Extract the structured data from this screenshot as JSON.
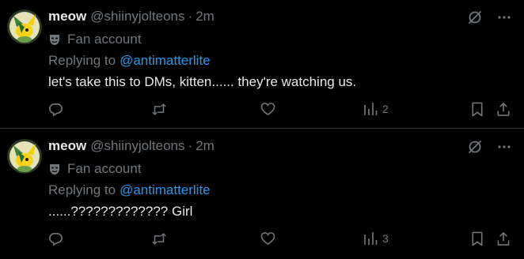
{
  "colors": {
    "background": "#000000",
    "text_primary": "#e7e9ea",
    "text_secondary": "#71767b",
    "link": "#1d9bf0",
    "divider": "#2f3336"
  },
  "posts": [
    {
      "display_name": "meow",
      "handle": "@shiinyjolteons",
      "separator": "·",
      "time": "2m",
      "label_icon": "mask-icon",
      "label": "Fan account",
      "replying_prefix": "Replying to",
      "replying_to": "@antimatterlite",
      "text": "let's take this to DMs, kitten...... they're watching us.",
      "views": "2"
    },
    {
      "display_name": "meow",
      "handle": "@shiinyjolteons",
      "separator": "·",
      "time": "2m",
      "label_icon": "mask-icon",
      "label": "Fan account",
      "replying_prefix": "Replying to",
      "replying_to": "@antimatterlite",
      "text": "......????????????? Girl",
      "views": "3"
    }
  ]
}
